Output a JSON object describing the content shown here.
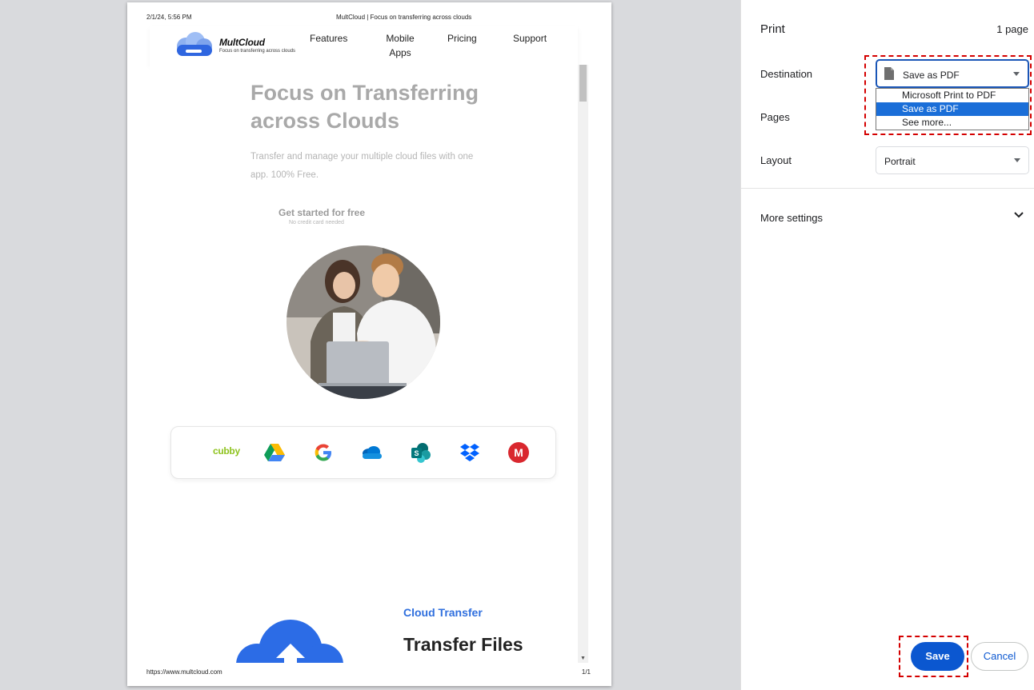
{
  "preview": {
    "header_date": "2/1/24, 5:56 PM",
    "header_title": "MultCloud | Focus on transferring across clouds",
    "footer_url": "https://www.multcloud.com",
    "footer_page": "1/1",
    "site": {
      "logo_name": "MultCloud",
      "logo_tagline": "Focus on transferring across clouds",
      "nav": [
        "Features",
        "Mobile Apps",
        "Pricing",
        "Support"
      ],
      "hero_title": "Focus on Transferring across Clouds",
      "hero_subtitle": "Transfer and manage your multiple cloud files with one app. 100% Free.",
      "cta_label": "Get started for free",
      "cta_note": "No credit card needed",
      "cloud_logos": [
        "cubby",
        "google-drive-icon",
        "google-icon",
        "onedrive-icon",
        "sharepoint-icon",
        "dropbox-icon",
        "mega-icon"
      ],
      "cubby_label": "cubby",
      "section_tag": "Cloud Transfer",
      "section_title": "Transfer Files"
    }
  },
  "settings": {
    "title": "Print",
    "page_count": "1 page",
    "destination_label": "Destination",
    "destination_value": "Save as PDF",
    "destination_options": [
      "Microsoft Print to PDF",
      "Save as PDF",
      "See more..."
    ],
    "destination_selected_index": 1,
    "pages_label": "Pages",
    "layout_label": "Layout",
    "layout_value": "Portrait",
    "more_settings_label": "More settings",
    "save_label": "Save",
    "cancel_label": "Cancel"
  },
  "colors": {
    "accent": "#0b57d0",
    "selected_option": "#1a6ed8",
    "highlight": "#d40000"
  }
}
